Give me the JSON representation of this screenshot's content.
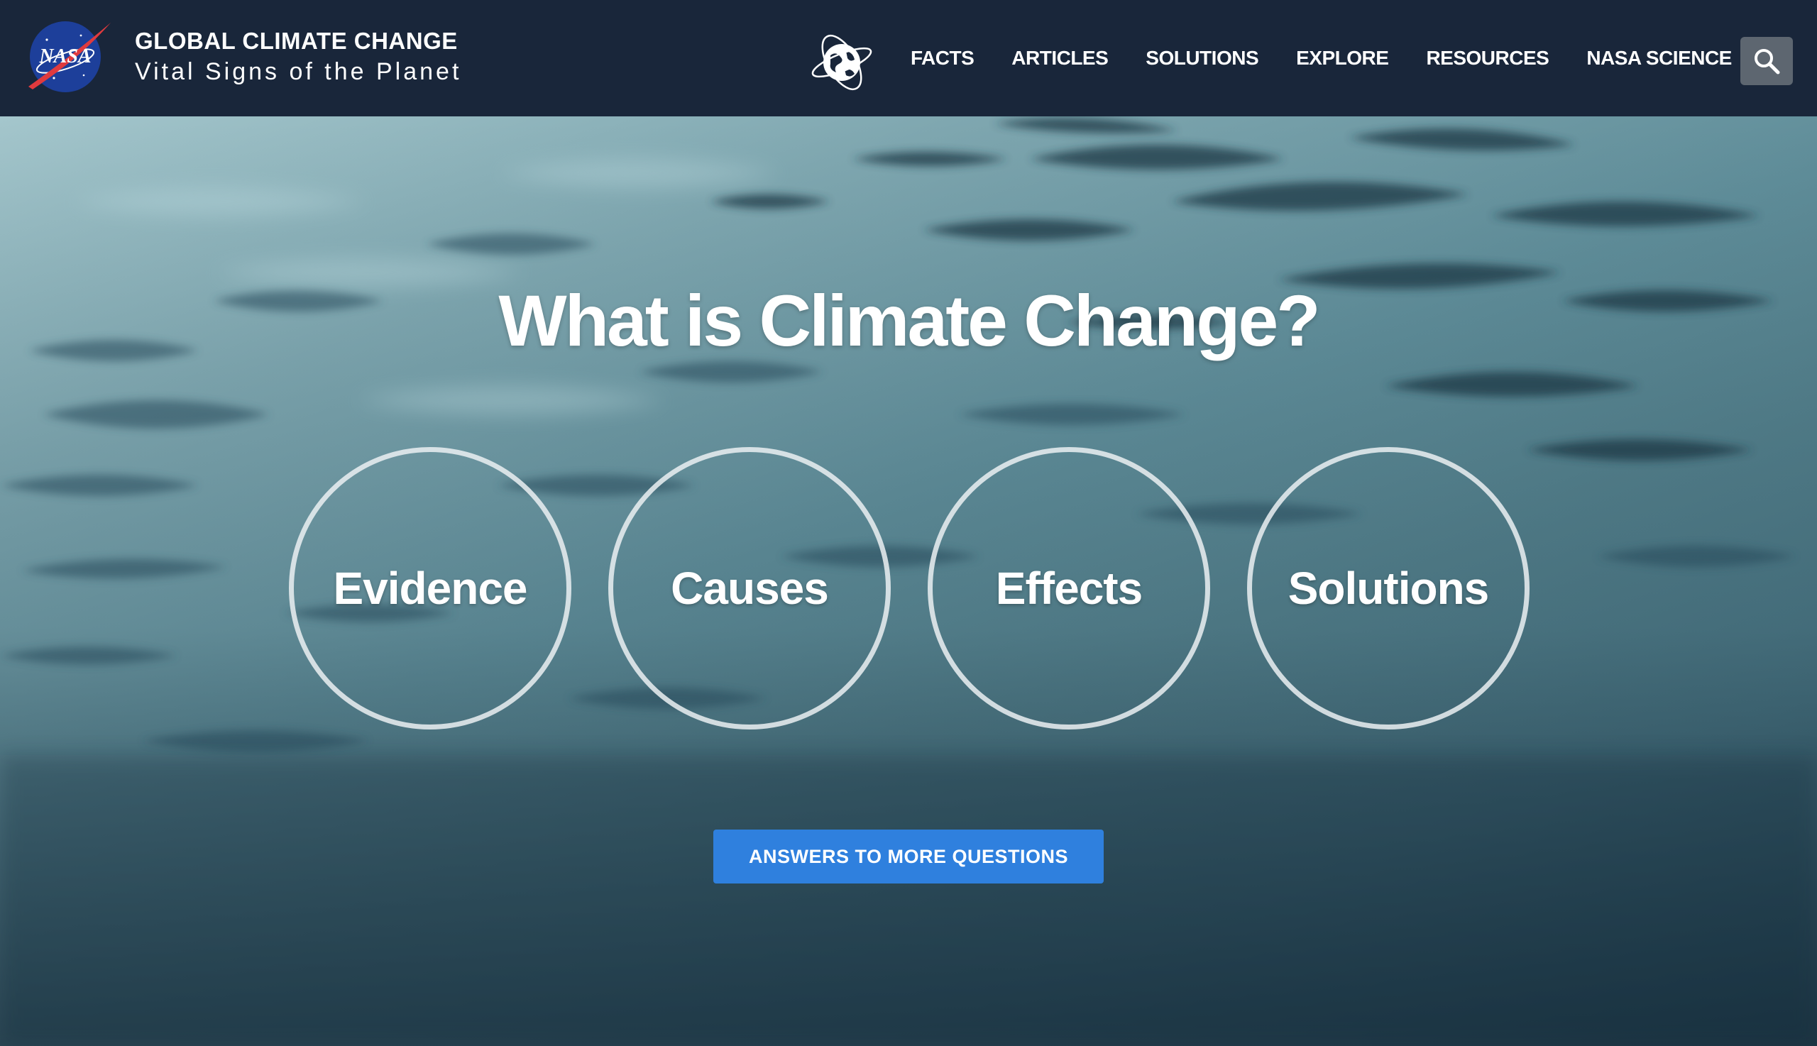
{
  "header": {
    "logo_icon": "nasa-meatball-icon",
    "logo_text": "NASA",
    "title": "GLOBAL CLIMATE CHANGE",
    "subtitle": "Vital Signs of the Planet",
    "globe_icon": "globe-orbit-icon",
    "nav": [
      {
        "label": "FACTS"
      },
      {
        "label": "ARTICLES"
      },
      {
        "label": "SOLUTIONS"
      },
      {
        "label": "EXPLORE"
      },
      {
        "label": "RESOURCES"
      },
      {
        "label": "NASA SCIENCE"
      }
    ],
    "search_icon": "search-icon"
  },
  "hero": {
    "title": "What is Climate Change?",
    "topics": [
      {
        "label": "Evidence"
      },
      {
        "label": "Causes"
      },
      {
        "label": "Effects"
      },
      {
        "label": "Solutions"
      }
    ],
    "cta_label": "ANSWERS TO MORE QUESTIONS"
  },
  "colors": {
    "header_bg": "#19263a",
    "cta_bg": "#2f80de",
    "search_bg": "#5d6670"
  }
}
